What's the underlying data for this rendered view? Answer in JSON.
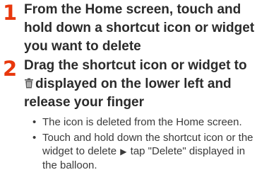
{
  "steps": [
    {
      "number": "1",
      "text": "From the Home screen, touch and hold down a shortcut icon or widget you want to delete"
    },
    {
      "number": "2",
      "text_before_icon": "Drag the shortcut icon or widget to",
      "icon": "trash-can-icon",
      "text_after_icon": "displayed on the lower left and release your finger"
    }
  ],
  "bullets": [
    {
      "text": "The icon is deleted from the Home screen."
    },
    {
      "text_before_arrow": "Touch and hold down the shortcut icon or the widget to delete",
      "arrow": "▶",
      "text_after_arrow": "tap \"Delete\" displayed in the balloon."
    }
  ],
  "colors": {
    "step_number": "#e8380d",
    "heading_text": "#2b2b2b",
    "body_text": "#3a3a3a",
    "icon": "#555555"
  }
}
